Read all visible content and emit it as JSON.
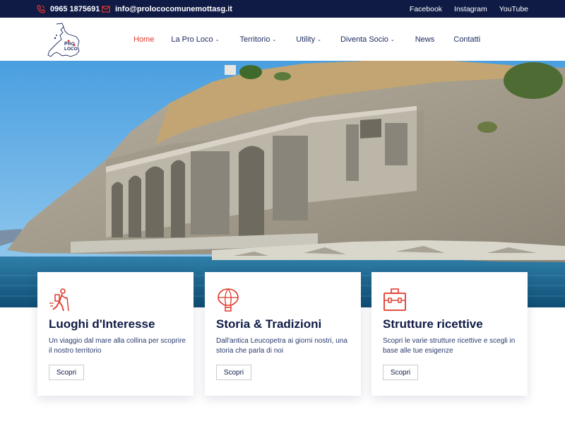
{
  "topbar": {
    "phone": "0965 1875691",
    "email": "info@prolococomunemottasg.it",
    "social": [
      "Facebook",
      "Instagram",
      "YouTube"
    ],
    "phone_icon": "phone-icon",
    "email_icon": "mail-icon"
  },
  "header": {
    "logo_text": "Pro Loco",
    "nav": [
      {
        "label": "Home",
        "active": true,
        "has_dropdown": false
      },
      {
        "label": "La Pro Loco",
        "active": false,
        "has_dropdown": true
      },
      {
        "label": "Territorio",
        "active": false,
        "has_dropdown": true
      },
      {
        "label": "Utility",
        "active": false,
        "has_dropdown": true
      },
      {
        "label": "Diventa Socio",
        "active": false,
        "has_dropdown": true
      },
      {
        "label": "News",
        "active": false,
        "has_dropdown": false
      },
      {
        "label": "Contatti",
        "active": false,
        "has_dropdown": false
      }
    ]
  },
  "cards": [
    {
      "icon": "hiker-icon",
      "title": "Luoghi d'Interesse",
      "text": "Un viaggio dal mare alla collina per scoprire il nostro territorio",
      "button": "Scopri"
    },
    {
      "icon": "hot-air-balloon-icon",
      "title": "Storia & Tradizioni",
      "text": "Dall'antica Leucopetra ai giorni nostri, una storia che parla di noi",
      "button": "Scopri"
    },
    {
      "icon": "suitcase-icon",
      "title": "Strutture ricettive",
      "text": "Scopri le varie strutture ricettive e scegli in base alle tue esigenze",
      "button": "Scopri"
    }
  ],
  "colors": {
    "navy": "#0f1b45",
    "accent_red": "#e0392b",
    "text": "#1b2a5e"
  }
}
